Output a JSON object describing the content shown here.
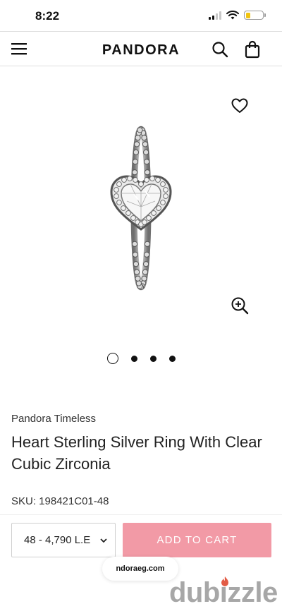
{
  "status_bar": {
    "time": "8:22",
    "icons": [
      "signal-icon",
      "wifi-icon",
      "battery-icon"
    ],
    "battery_color": "#f1c40f"
  },
  "header": {
    "brand_prefix": "PANDO",
    "brand_accent_letter": "R",
    "brand_suffix": "A",
    "icons": [
      "menu-icon",
      "search-icon",
      "shopping-bag-icon"
    ]
  },
  "gallery": {
    "icons": [
      "heart-icon",
      "zoom-in-icon"
    ],
    "image_subject": "heart-ring",
    "slides_count": 4,
    "active_slide": 1
  },
  "product": {
    "collection": "Pandora Timeless",
    "title": "Heart Sterling Silver Ring With Clear Cubic Zirconia",
    "sku": "SKU: 198421C01-48"
  },
  "purchase": {
    "size_value": "48 - 4,790 L.E",
    "add_to_cart_label": "ADD TO CART",
    "add_to_cart_color": "#f29aa6"
  },
  "browser": {
    "url": "ndoraeg.com"
  },
  "watermark": {
    "text": "dubizzle"
  }
}
